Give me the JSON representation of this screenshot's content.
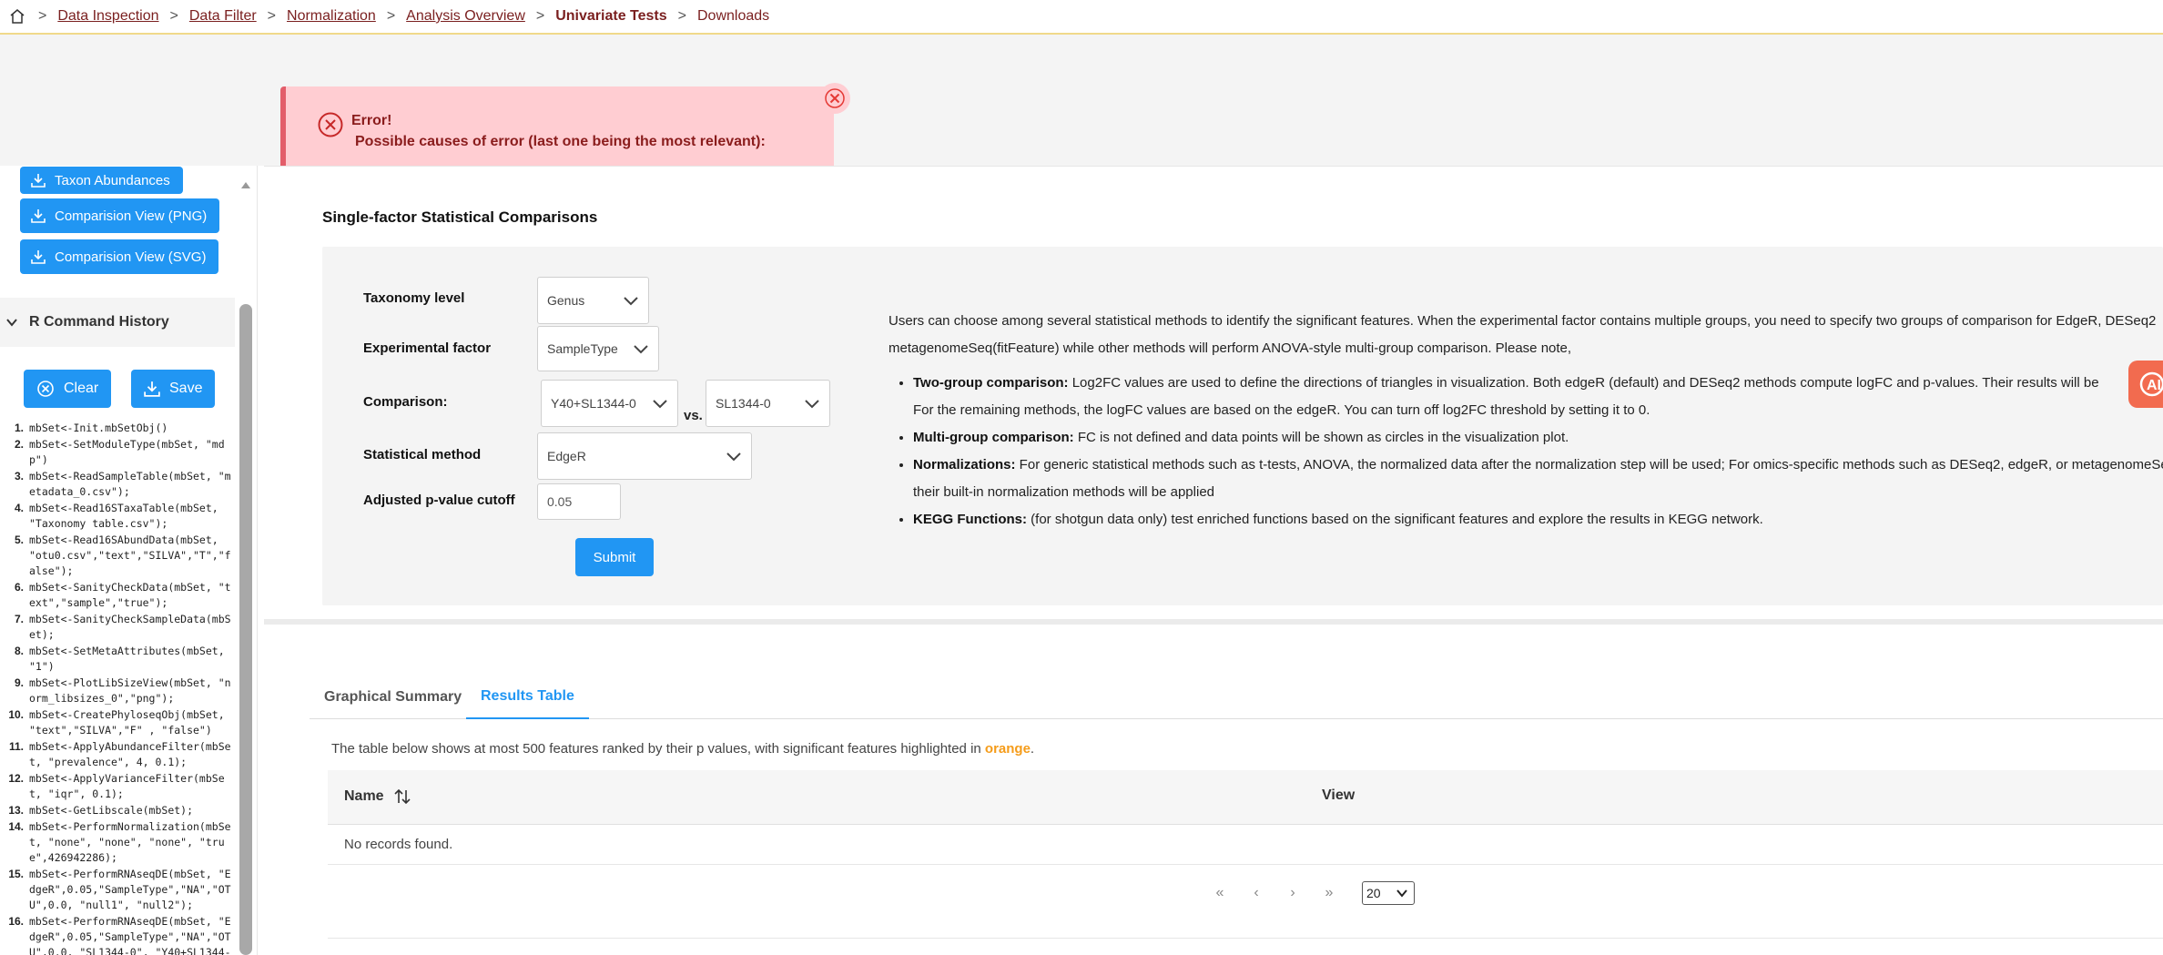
{
  "breadcrumb": {
    "items": [
      {
        "label": "Data Inspection"
      },
      {
        "label": "Data Filter"
      },
      {
        "label": "Normalization"
      },
      {
        "label": "Analysis Overview"
      }
    ],
    "active": "Univariate Tests",
    "last": "Downloads"
  },
  "error": {
    "title": "Error!",
    "message": "Possible causes of error (last one being the most relevant):"
  },
  "sidebar": {
    "downloads": [
      {
        "label": "Taxon Abundances"
      },
      {
        "label": "Comparision View (PNG)"
      },
      {
        "label": "Comparision View (SVG)"
      }
    ],
    "history_title": "R Command History",
    "clear_label": "Clear",
    "save_label": "Save",
    "commands": [
      {
        "num": "1.",
        "text": "mbSet<-Init.mbSetObj()"
      },
      {
        "num": "2.",
        "text": "mbSet<-SetModuleType(mbSet, \"mdp\")"
      },
      {
        "num": "3.",
        "text": "mbSet<-ReadSampleTable(mbSet, \"metadata_0.csv\");"
      },
      {
        "num": "4.",
        "text": "mbSet<-Read16STaxaTable(mbSet, \"Taxonomy table.csv\");"
      },
      {
        "num": "5.",
        "text": "mbSet<-Read16SAbundData(mbSet, \"otu0.csv\",\"text\",\"SILVA\",\"T\",\"false\");"
      },
      {
        "num": "6.",
        "text": "mbSet<-SanityCheckData(mbSet, \"text\",\"sample\",\"true\");"
      },
      {
        "num": "7.",
        "text": "mbSet<-SanityCheckSampleData(mbSet);"
      },
      {
        "num": "8.",
        "text": "mbSet<-SetMetaAttributes(mbSet, \"1\")"
      },
      {
        "num": "9.",
        "text": "mbSet<-PlotLibSizeView(mbSet, \"norm_libsizes_0\",\"png\");"
      },
      {
        "num": "10.",
        "text": "mbSet<-CreatePhyloseqObj(mbSet, \"text\",\"SILVA\",\"F\" , \"false\")"
      },
      {
        "num": "11.",
        "text": "mbSet<-ApplyAbundanceFilter(mbSet, \"prevalence\", 4, 0.1);"
      },
      {
        "num": "12.",
        "text": "mbSet<-ApplyVarianceFilter(mbSet, \"iqr\", 0.1);"
      },
      {
        "num": "13.",
        "text": "mbSet<-GetLibscale(mbSet);"
      },
      {
        "num": "14.",
        "text": "mbSet<-PerformNormalization(mbSet, \"none\", \"none\", \"none\", \"true\",426942286);"
      },
      {
        "num": "15.",
        "text": "mbSet<-PerformRNAseqDE(mbSet, \"EdgeR\",0.05,\"SampleType\",\"NA\",\"OTU\",0.0, \"null1\", \"null2\");"
      },
      {
        "num": "16.",
        "text": "mbSet<-PerformRNAseqDE(mbSet, \"EdgeR\",0.05,\"SampleType\",\"NA\",\"OTU\",0.0, \"SL1344-0\", \"Y40+SL1344-"
      }
    ]
  },
  "main": {
    "title": "Single-factor Statistical Comparisons",
    "form": {
      "taxonomy_label": "Taxonomy level",
      "taxonomy_value": "Genus",
      "factor_label": "Experimental factor",
      "factor_value": "SampleType",
      "comparison_label": "Comparison:",
      "comparison_a": "Y40+SL1344-0",
      "vs": "vs.",
      "comparison_b": "SL1344-0",
      "method_label": "Statistical method",
      "method_value": "EdgeR",
      "pval_label": "Adjusted p-value cutoff",
      "pval_value": "0.05",
      "submit_label": "Submit"
    },
    "description": {
      "line1": "Users can choose among several statistical methods to identify the significant features. When the experimental factor contains multiple groups, you need to specify two groups of comparison for EdgeR, DESeq2",
      "line2": "metagenomeSeq(fitFeature) while other methods will perform ANOVA-style multi-group comparison. Please note,",
      "bullets": [
        {
          "title": "Two-group comparison:",
          "text": " Log2FC values are used to define the directions of triangles in visualization. Both edgeR (default) and DESeq2 methods compute logFC and p-values. Their results will be",
          "text2": "For the remaining methods, the logFC values are based on the edgeR. You can turn off log2FC threshold by setting it to 0."
        },
        {
          "title": "Multi-group comparison:",
          "text": " FC is not defined and data points will be shown as circles in the visualization plot.",
          "text2": ""
        },
        {
          "title": "Normalizations:",
          "text": " For generic statistical methods such as t-tests, ANOVA, the normalized data after the normalization step will be used; For omics-specific methods such as DESeq2, edgeR, or metagenomeSeq",
          "text2": "their built-in normalization methods will be applied"
        },
        {
          "title": "KEGG Functions:",
          "text": " (for shotgun data only) test enriched functions based on the significant features and explore the results in KEGG network.",
          "text2": ""
        }
      ]
    },
    "ai_badge": "AI"
  },
  "results": {
    "tabs": [
      {
        "label": "Graphical Summary"
      },
      {
        "label": "Results Table"
      }
    ],
    "note_prefix": "The table below shows at most 500 features ranked by their p values, with significant features highlighted in ",
    "note_highlight": "orange",
    "note_suffix": ".",
    "columns": {
      "name": "Name",
      "view": "View"
    },
    "empty": "No records found.",
    "pager": {
      "first": "«",
      "prev": "‹",
      "next": "›",
      "last": "»",
      "rows": "20"
    }
  },
  "colors": {
    "accent": "#2196f3",
    "error_bg": "#ffcdd2",
    "error_text": "#8a1c1c",
    "breadcrumb": "#7a1f1f",
    "highlight": "#f59c1a"
  }
}
